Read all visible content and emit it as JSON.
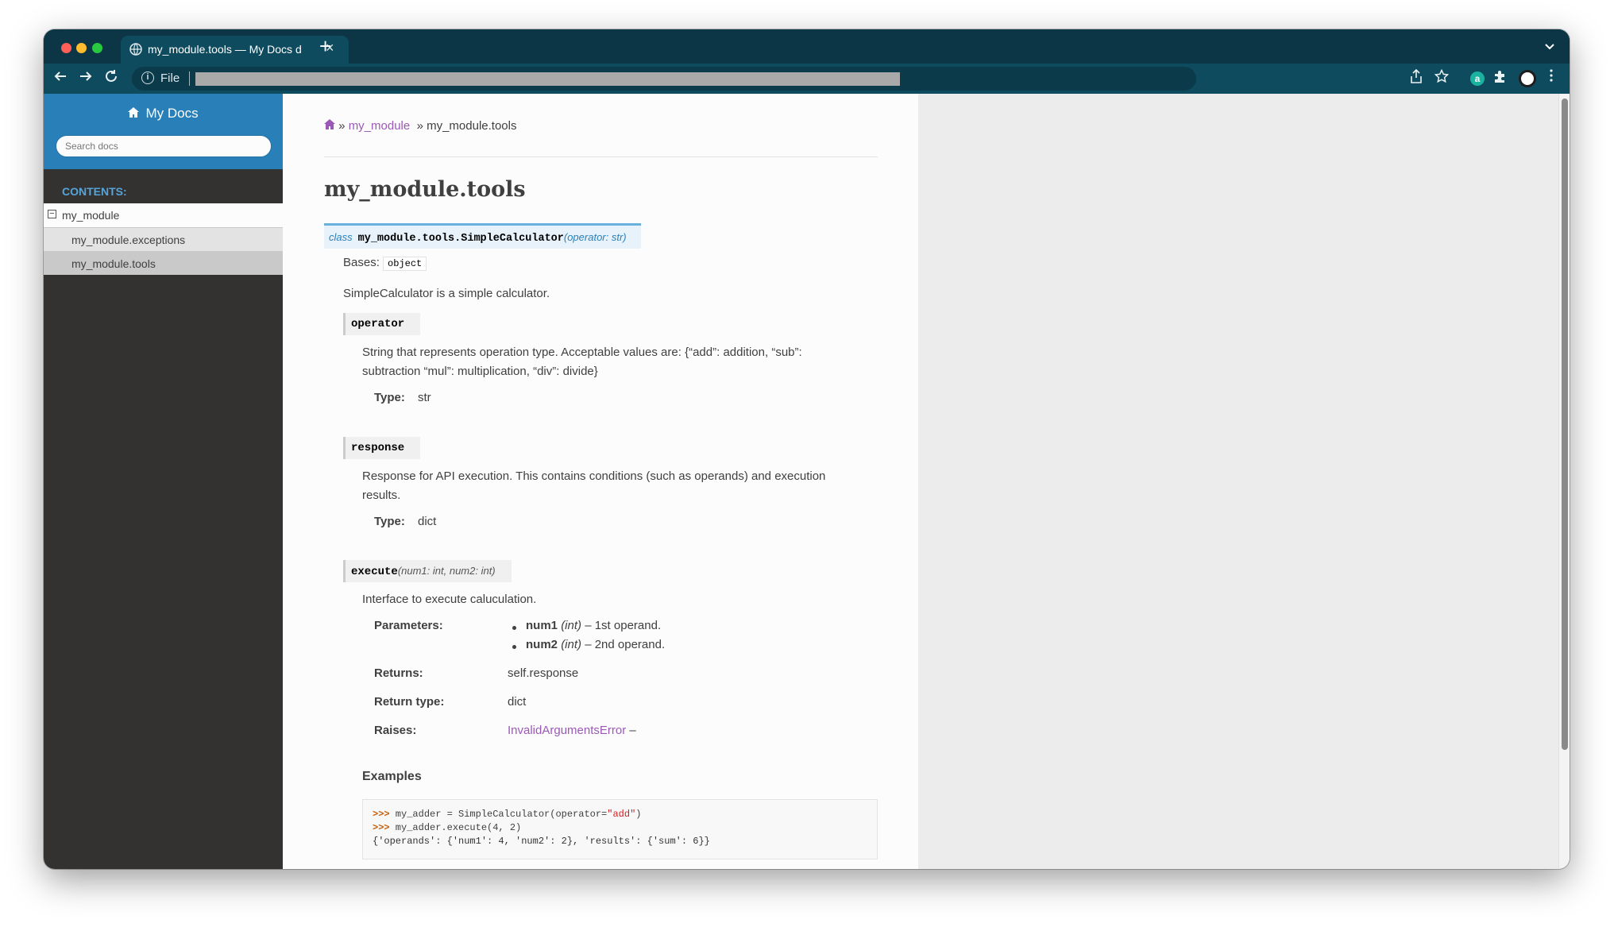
{
  "browser": {
    "tab_title": "my_module.tools — My Docs d",
    "tab_close": "×",
    "new_tab": "+",
    "omnibox_scheme": "File",
    "tab_menu": "⌄",
    "ext_a": "a"
  },
  "sidebar": {
    "project_name": "My Docs",
    "search_placeholder": "Search docs",
    "contents_caption": "CONTENTS:",
    "toc": [
      {
        "label": "my_module",
        "level": 1,
        "expanded": true
      },
      {
        "label": "my_module.exceptions",
        "level": 2
      },
      {
        "label": "my_module.tools",
        "level": 2,
        "current": true
      }
    ]
  },
  "breadcrumb": {
    "sep1": "»",
    "module_link": "my_module",
    "sep2": "»",
    "current": "my_module.tools"
  },
  "page_title": "my_module.tools",
  "class_sig": {
    "keyword": "class",
    "name": "my_module.tools.SimpleCalculator",
    "params": "(operator: str)"
  },
  "bases_label": "Bases:",
  "bases_value": "object",
  "class_desc": "SimpleCalculator is a simple calculator.",
  "attributes": [
    {
      "name": "operator",
      "desc_line1": "String that represents operation type. Acceptable values are: {“add”: addition, “sub”:",
      "desc_line2": "subtraction “mul”: multiplication, “div”: divide}",
      "type_label": "Type:",
      "type_value": "str"
    },
    {
      "name": "response",
      "desc_line1": "Response for API execution. This contains conditions (such as operands) and execution",
      "desc_line2": "results.",
      "type_label": "Type:",
      "type_value": "dict"
    }
  ],
  "method": {
    "name": "execute",
    "params": "(num1: int, num2: int)",
    "desc": "Interface to execute caluculation.",
    "parameters_label": "Parameters:",
    "parameters": [
      {
        "name": "num1",
        "type": "(int)",
        "desc": "– 1st operand."
      },
      {
        "name": "num2",
        "type": "(int)",
        "desc": "– 2nd operand."
      }
    ],
    "returns_label": "Returns:",
    "returns_value": "self.response",
    "return_type_label": "Return type:",
    "return_type_value": "dict",
    "raises_label": "Raises:",
    "raises_value": "InvalidArgumentsError",
    "raises_dash": "–"
  },
  "examples": {
    "heading": "Examples",
    "line1_prompt": ">>>",
    "line1_pre": " my_adder = SimpleCalculator(operator=",
    "line1_str": "\"add\"",
    "line1_post": ")",
    "line2_prompt": ">>>",
    "line2_code": " my_adder.execute(4, 2)",
    "line3_output": "{'operands': {'num1': 4, 'num2': 2}, 'results': {'sum': 6}}"
  },
  "colors": {
    "sidebar_bg": "#343131",
    "sidebar_header": "#2980b9",
    "link": "#9b59b6",
    "signature_bg": "#e7f2fa",
    "browser_chrome": "#0f4b5e"
  }
}
